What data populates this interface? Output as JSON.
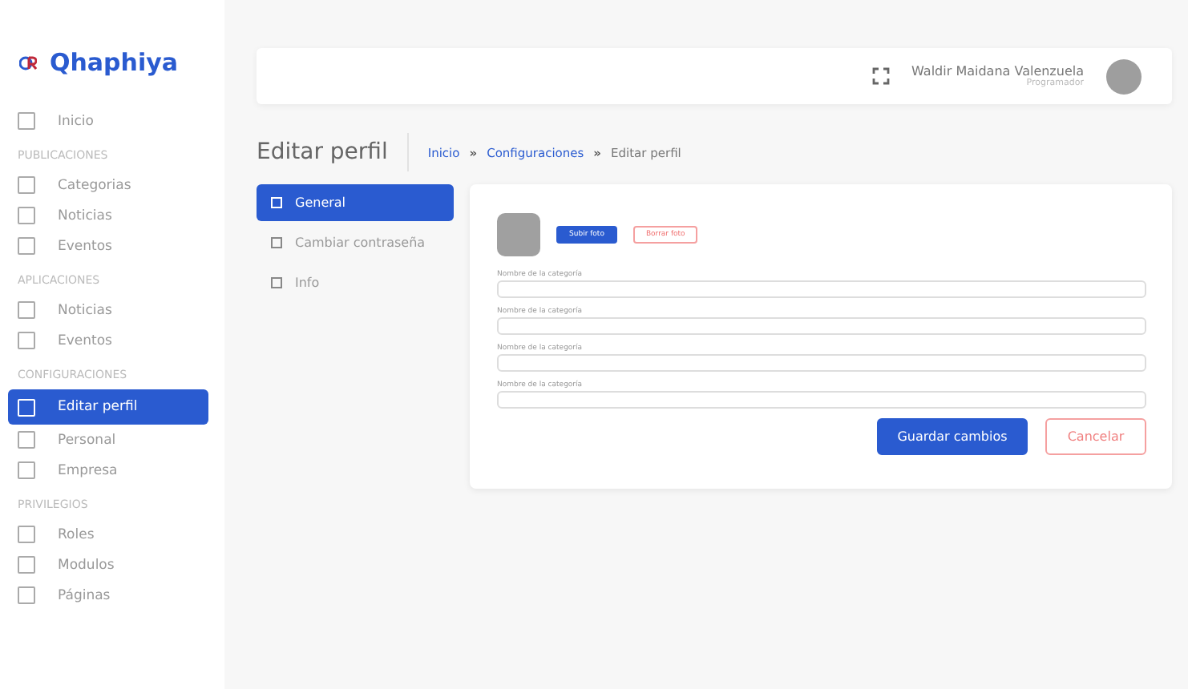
{
  "brand": {
    "name": "Qhaphiya"
  },
  "sidebar": {
    "sections": [
      {
        "items": [
          {
            "label": "Inicio",
            "selected": false
          }
        ]
      },
      {
        "title": "PUBLICACIONES",
        "items": [
          {
            "label": "Categorias",
            "selected": false
          },
          {
            "label": "Noticias",
            "selected": false
          },
          {
            "label": "Eventos",
            "selected": false
          }
        ]
      },
      {
        "title": "APLICACIONES",
        "items": [
          {
            "label": "Noticias",
            "selected": false
          },
          {
            "label": "Eventos",
            "selected": false
          }
        ]
      },
      {
        "title": "CONFIGURACIONES",
        "items": [
          {
            "label": "Editar perfil",
            "selected": true
          },
          {
            "label": "Personal",
            "selected": false
          },
          {
            "label": "Empresa",
            "selected": false
          }
        ]
      },
      {
        "title": "PRIVILEGIOS",
        "items": [
          {
            "label": "Roles",
            "selected": false
          },
          {
            "label": "Modulos",
            "selected": false
          },
          {
            "label": "Páginas",
            "selected": false
          }
        ]
      }
    ]
  },
  "user": {
    "name": "Waldir Maidana Valenzuela",
    "role": "Programador"
  },
  "page_title": "Editar perfil",
  "breadcrumb": [
    {
      "label": "Inicio",
      "kind": "link"
    },
    {
      "label": "Configuraciones",
      "kind": "link"
    },
    {
      "label": "Editar perfil",
      "kind": "current"
    }
  ],
  "breadcrumb_separator": "»",
  "tabs": [
    {
      "label": "General",
      "selected": true
    },
    {
      "label": "Cambiar contraseña",
      "selected": false
    },
    {
      "label": "Info",
      "selected": false
    }
  ],
  "photo_buttons": {
    "upload": "Subir foto",
    "delete": "Borrar foto"
  },
  "fields": [
    {
      "label": "Nombre de la categoría"
    },
    {
      "label": "Nombre de la categoría"
    },
    {
      "label": "Nombre de la categoría"
    },
    {
      "label": "Nombre de la categoría"
    }
  ],
  "actions": {
    "save": "Guardar cambios",
    "cancel": "Cancelar"
  }
}
